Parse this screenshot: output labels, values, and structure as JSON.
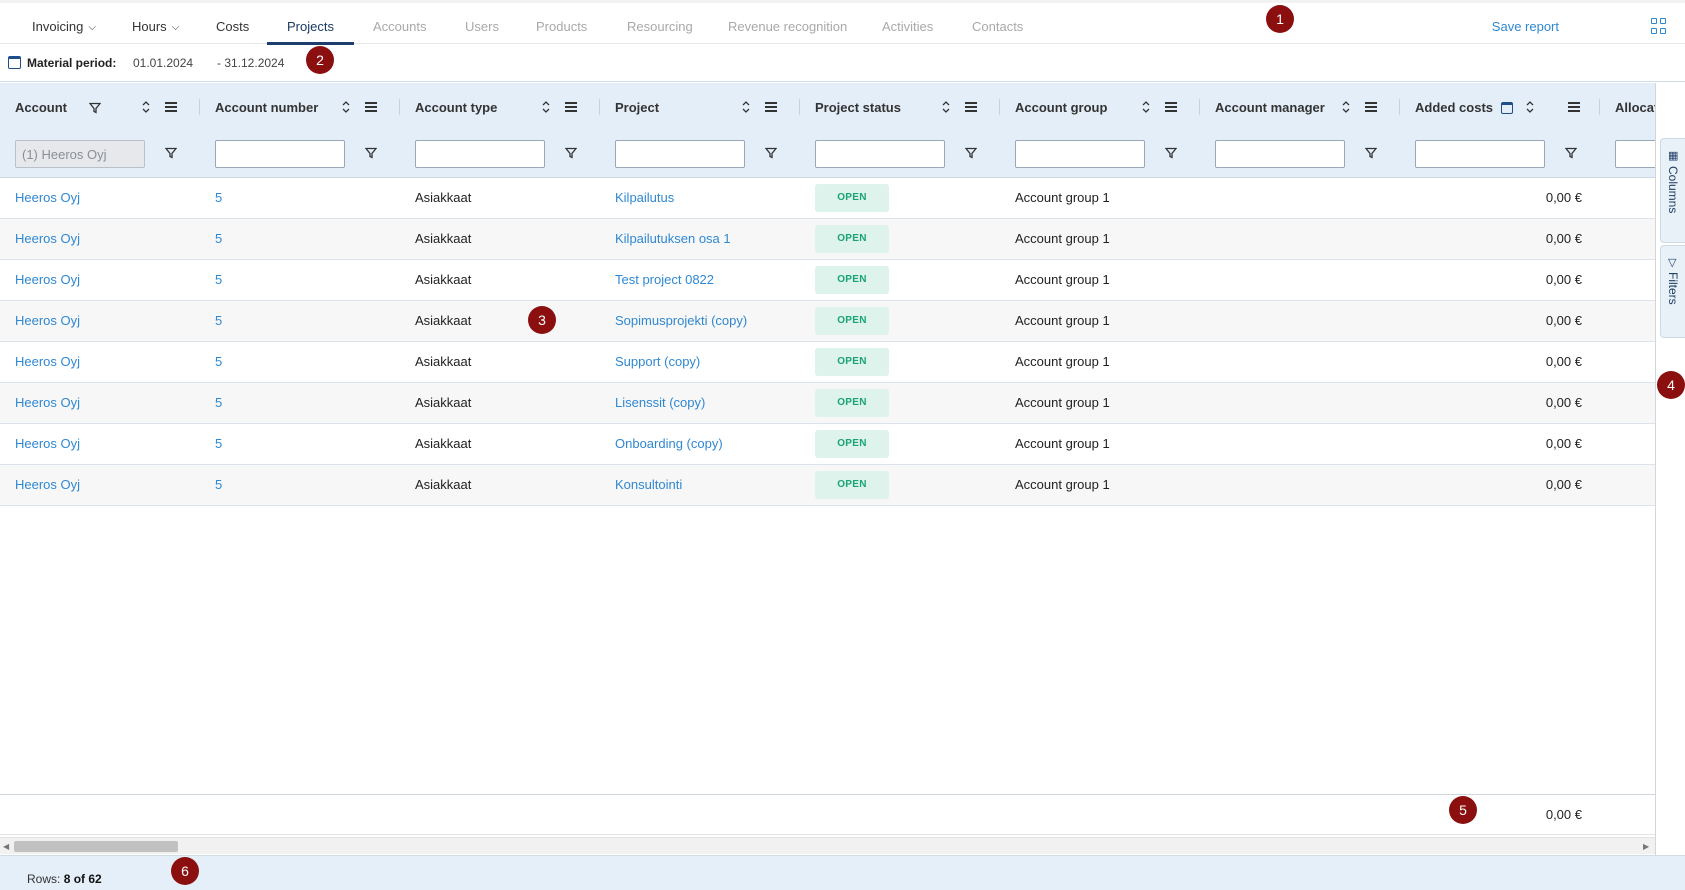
{
  "nav": {
    "tabs": [
      {
        "label": "Invoicing",
        "state": "normal",
        "dropdown": true
      },
      {
        "label": "Hours",
        "state": "normal",
        "dropdown": true
      },
      {
        "label": "Costs",
        "state": "normal",
        "dropdown": false
      },
      {
        "label": "Projects",
        "state": "active",
        "dropdown": false
      },
      {
        "label": "Accounts",
        "state": "disabled",
        "dropdown": false
      },
      {
        "label": "Users",
        "state": "disabled",
        "dropdown": false
      },
      {
        "label": "Products",
        "state": "disabled",
        "dropdown": false
      },
      {
        "label": "Resourcing",
        "state": "disabled",
        "dropdown": false
      },
      {
        "label": "Revenue recognition",
        "state": "disabled",
        "dropdown": false
      },
      {
        "label": "Activities",
        "state": "disabled",
        "dropdown": false
      },
      {
        "label": "Contacts",
        "state": "disabled",
        "dropdown": false
      }
    ],
    "save_report": "Save report",
    "layout_icon": "grid-icon"
  },
  "period": {
    "label": "Material period:",
    "from": "01.01.2024",
    "to": "- 31.12.2024",
    "icon": "calendar-icon"
  },
  "badges": [
    "1",
    "2",
    "3",
    "4",
    "5",
    "6"
  ],
  "columns": [
    {
      "title": "Account",
      "filter_value": "(1) Heeros Oyj",
      "filtered": true
    },
    {
      "title": "Account number",
      "filter_value": ""
    },
    {
      "title": "Account type",
      "filter_value": ""
    },
    {
      "title": "Project",
      "filter_value": ""
    },
    {
      "title": "Project status",
      "filter_value": ""
    },
    {
      "title": "Account group",
      "filter_value": ""
    },
    {
      "title": "Account manager",
      "filter_value": ""
    },
    {
      "title": "Added costs",
      "filter_value": "",
      "calendar": true
    },
    {
      "title": "Allocat",
      "filter_value": ""
    }
  ],
  "rows": [
    {
      "account": "Heeros Oyj",
      "account_number": "5",
      "account_type": "Asiakkaat",
      "project": "Kilpailutus",
      "status": "OPEN",
      "account_group": "Account group 1",
      "account_manager": "",
      "added_costs": "0,00 €"
    },
    {
      "account": "Heeros Oyj",
      "account_number": "5",
      "account_type": "Asiakkaat",
      "project": "Kilpailutuksen osa 1",
      "status": "OPEN",
      "account_group": "Account group 1",
      "account_manager": "",
      "added_costs": "0,00 €"
    },
    {
      "account": "Heeros Oyj",
      "account_number": "5",
      "account_type": "Asiakkaat",
      "project": "Test project 0822",
      "status": "OPEN",
      "account_group": "Account group 1",
      "account_manager": "",
      "added_costs": "0,00 €"
    },
    {
      "account": "Heeros Oyj",
      "account_number": "5",
      "account_type": "Asiakkaat",
      "project": "Sopimusprojekti (copy)",
      "status": "OPEN",
      "account_group": "Account group 1",
      "account_manager": "",
      "added_costs": "0,00 €"
    },
    {
      "account": "Heeros Oyj",
      "account_number": "5",
      "account_type": "Asiakkaat",
      "project": "Support (copy)",
      "status": "OPEN",
      "account_group": "Account group 1",
      "account_manager": "",
      "added_costs": "0,00 €"
    },
    {
      "account": "Heeros Oyj",
      "account_number": "5",
      "account_type": "Asiakkaat",
      "project": "Lisenssit (copy)",
      "status": "OPEN",
      "account_group": "Account group 1",
      "account_manager": "",
      "added_costs": "0,00 €"
    },
    {
      "account": "Heeros Oyj",
      "account_number": "5",
      "account_type": "Asiakkaat",
      "project": "Onboarding (copy)",
      "status": "OPEN",
      "account_group": "Account group 1",
      "account_manager": "",
      "added_costs": "0,00 €"
    },
    {
      "account": "Heeros Oyj",
      "account_number": "5",
      "account_type": "Asiakkaat",
      "project": "Konsultointi",
      "status": "OPEN",
      "account_group": "Account group 1",
      "account_manager": "",
      "added_costs": "0,00 €"
    }
  ],
  "totals": {
    "added_costs": "0,00 €"
  },
  "side_panel": {
    "columns_label": "Columns",
    "filters_label": "Filters"
  },
  "footer": {
    "rows_label": "Rows:",
    "rows_value": "8 of 62"
  },
  "colors": {
    "accent": "#2f88d2",
    "header_bg": "#e3eef8",
    "status_bg": "#ddf3ec",
    "status_text": "#1aa374",
    "badge": "#8b0f0f",
    "active_tab": "#1d3f6e"
  }
}
